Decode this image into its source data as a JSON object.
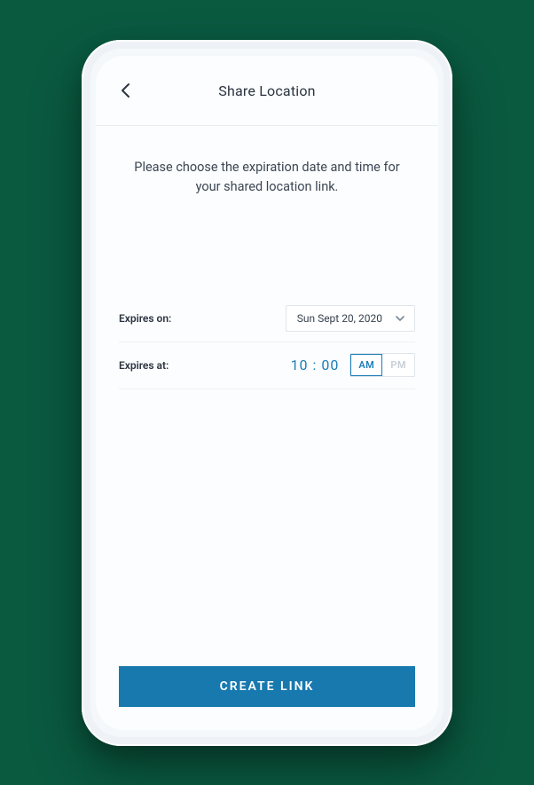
{
  "header": {
    "title": "Share Location"
  },
  "intro": "Please choose the expiration date and time for your shared location link.",
  "expires_on": {
    "label": "Expires on:",
    "value": "Sun Sept 20, 2020"
  },
  "expires_at": {
    "label": "Expires at:",
    "hour": "10",
    "sep": " : ",
    "minute": "00",
    "am_label": "AM",
    "pm_label": "PM",
    "selected": "AM"
  },
  "cta": "CREATE LINK",
  "colors": {
    "accent": "#1879af",
    "link_blue": "#1b7db8"
  }
}
